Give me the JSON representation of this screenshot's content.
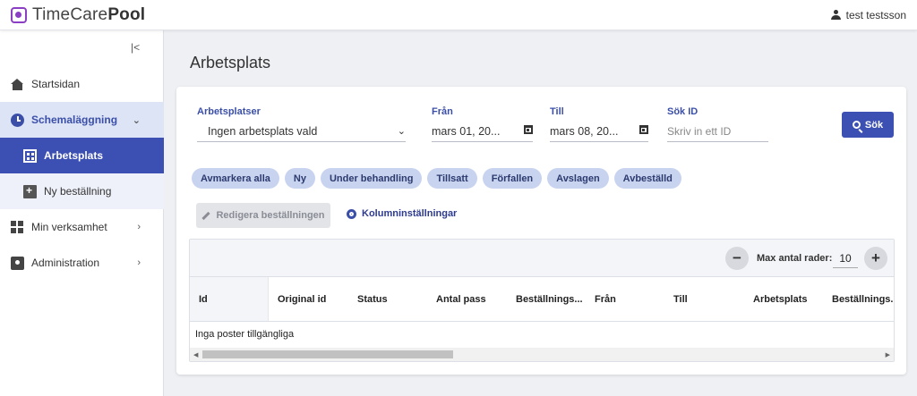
{
  "app": {
    "logo_name": "TimeCare",
    "logo_bold": "Pool",
    "user": "test testsson"
  },
  "sidebar": {
    "collapse_label": "|<",
    "items": [
      {
        "label": "Startsidan",
        "icon": "home-icon"
      },
      {
        "label": "Schemaläggning",
        "icon": "clock-icon"
      },
      {
        "label": "Arbetsplats",
        "icon": "building-icon"
      },
      {
        "label": "Ny beställning",
        "icon": "document-add-icon"
      },
      {
        "label": "Min verksamhet",
        "icon": "widgets-icon"
      },
      {
        "label": "Administration",
        "icon": "badge-icon"
      }
    ]
  },
  "page": {
    "title": "Arbetsplats"
  },
  "filters": {
    "workplaces_label": "Arbetsplatser",
    "workplaces_value": "Ingen arbetsplats vald",
    "from_label": "Från",
    "from_value": "mars 01, 20...",
    "to_label": "Till",
    "to_value": "mars 08, 20...",
    "search_id_label": "Sök ID",
    "search_id_placeholder": "Skriv in ett ID",
    "search_button": "Sök"
  },
  "chips": [
    "Avmarkera alla",
    "Ny",
    "Under behandling",
    "Tillsatt",
    "Förfallen",
    "Avslagen",
    "Avbeställd"
  ],
  "actions": {
    "edit": "Redigera beställningen",
    "columns": "Kolumninställningar"
  },
  "table": {
    "max_rows_label": "Max antal rader:",
    "max_rows_value": "10",
    "columns": [
      "Id",
      "Original id",
      "Status",
      "Antal pass",
      "Beställnings...",
      "Från",
      "Till",
      "Arbetsplats",
      "Beställnings..."
    ],
    "empty_text": "Inga poster tillgängliga"
  },
  "colors": {
    "primary": "#3c4fb3",
    "chip": "#c7d3ef",
    "logo": "#8b3fc4"
  }
}
